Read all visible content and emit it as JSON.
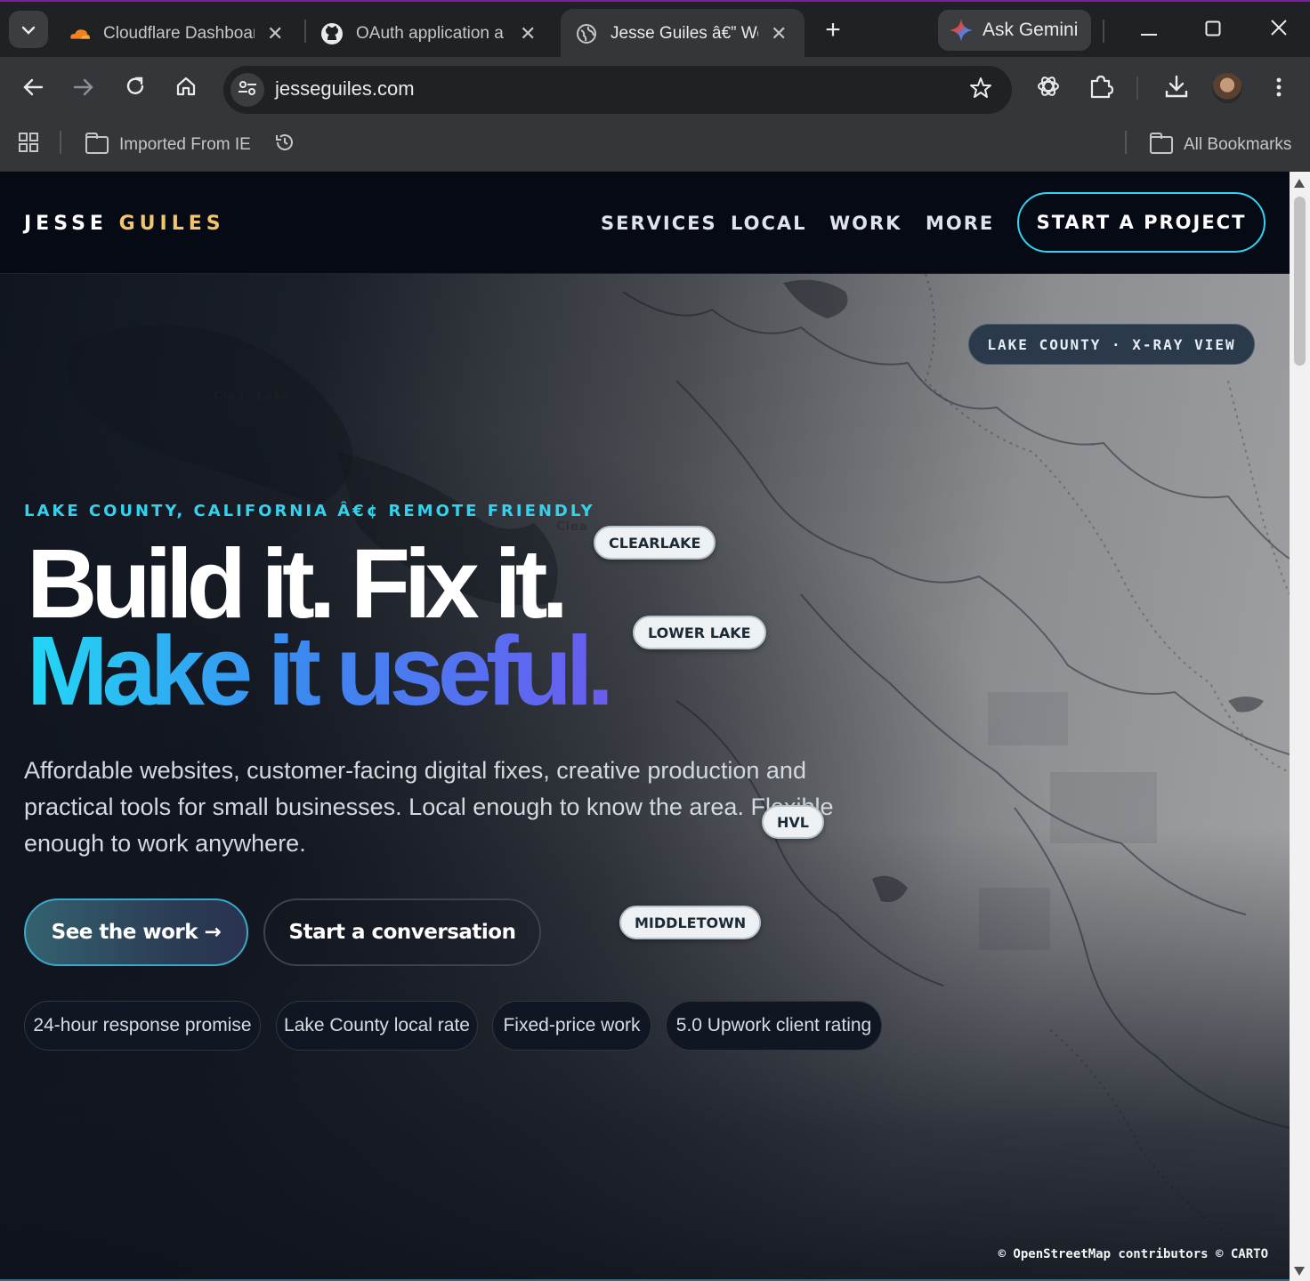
{
  "browser": {
    "tabs": [
      {
        "title": "Cloudflare Dashboard",
        "icon": "cloudflare-icon",
        "active": false
      },
      {
        "title": "OAuth application a",
        "icon": "github-icon",
        "active": false
      },
      {
        "title": "Jesse Guiles â€” Web",
        "icon": "globe-icon",
        "active": true
      }
    ],
    "new_tab_label": "+",
    "gemini_label": "Ask Gemini",
    "url": "jesseguiles.com",
    "bookmarks": {
      "imported": "Imported From IE",
      "all": "All Bookmarks"
    }
  },
  "site": {
    "logo_first": "JESSE",
    "logo_second": "GUILES",
    "nav": [
      "SERVICES",
      "LOCAL",
      "WORK",
      "MORE"
    ],
    "cta": "START A PROJECT",
    "hero": {
      "badge": "LAKE COUNTY · X-RAY VIEW",
      "eyebrow": "LAKE COUNTY, CALIFORNIA Â€¢ REMOTE FRIENDLY",
      "headline_line1": "Build it. Fix it.",
      "headline_line2": "Make it useful.",
      "lede": "Affordable websites, customer-facing digital fixes, creative production and practical tools for small businesses. Local enough to know the area. Flexible enough to work anywhere.",
      "primary_button": "See the work →",
      "secondary_button": "Start a conversation",
      "trust_pills": [
        "24-hour response promise",
        "Lake County local rate",
        "Fixed-price work",
        "5.0 Upwork client rating"
      ]
    },
    "map": {
      "towns": [
        "CLEARLAKE",
        "LOWER LAKE",
        "HVL",
        "MIDDLETOWN"
      ],
      "base_labels": [
        "Clear Lake",
        "Clea",
        "Calistoga"
      ],
      "attribution": "© OpenStreetMap contributors © CARTO"
    }
  },
  "colors": {
    "accent_cyan": "#32d3ee",
    "logo_gold": "#f2c46d",
    "gradient_start": "#22d9f5",
    "gradient_end": "#6a5cf0"
  }
}
